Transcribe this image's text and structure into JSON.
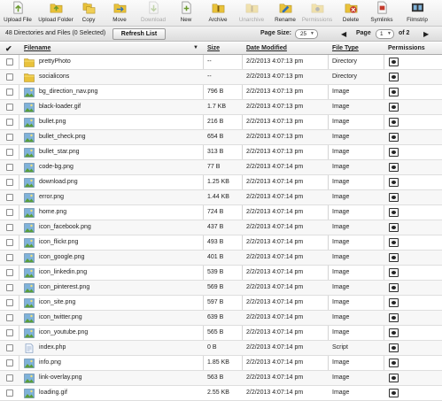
{
  "toolbar": {
    "buttons": [
      {
        "label": "Upload File",
        "icon": "upload-file-icon",
        "enabled": true
      },
      {
        "label": "Upload Folder",
        "icon": "upload-folder-icon",
        "enabled": true
      },
      {
        "label": "Copy",
        "icon": "copy-icon",
        "enabled": true
      },
      {
        "label": "Move",
        "icon": "move-icon",
        "enabled": true
      },
      {
        "label": "Download",
        "icon": "download-icon",
        "enabled": false
      },
      {
        "label": "New",
        "icon": "new-icon",
        "enabled": true
      },
      {
        "label": "Archive",
        "icon": "archive-icon",
        "enabled": true
      },
      {
        "label": "Unarchive",
        "icon": "unarchive-icon",
        "enabled": false
      },
      {
        "label": "Rename",
        "icon": "rename-icon",
        "enabled": true
      },
      {
        "label": "Permissions",
        "icon": "permissions-icon",
        "enabled": false
      },
      {
        "label": "Delete",
        "icon": "delete-icon",
        "enabled": true
      },
      {
        "label": "Symlinks",
        "icon": "symlinks-icon",
        "enabled": true
      },
      {
        "label": "Filmstrip",
        "icon": "filmstrip-icon",
        "enabled": true
      }
    ]
  },
  "status": {
    "summary": "48 Directories and Files (0 Selected)",
    "refresh_label": "Refresh List",
    "page_size_label": "Page Size:",
    "page_size_value": "25",
    "prev_icon": "prev-page-icon",
    "page_label": "Page",
    "page_value": "1",
    "page_of": "of 2",
    "next_icon": "next-page-icon"
  },
  "table": {
    "headers": {
      "check": "✔",
      "filename": "Filename",
      "size": "Size",
      "date": "Date Modified",
      "type": "File Type",
      "permissions": "Permissions"
    },
    "rows": [
      {
        "name": "prettyPhoto",
        "size": "--",
        "date": "2/2/2013 4:07:13 pm",
        "type": "Directory",
        "icon": "folder-icon"
      },
      {
        "name": "socialicons",
        "size": "--",
        "date": "2/2/2013 4:07:13 pm",
        "type": "Directory",
        "icon": "folder-icon"
      },
      {
        "name": "bg_direction_nav.png",
        "size": "796 B",
        "date": "2/2/2013 4:07:13 pm",
        "type": "Image",
        "icon": "image-file-icon"
      },
      {
        "name": "black-loader.gif",
        "size": "1.7 KB",
        "date": "2/2/2013 4:07:13 pm",
        "type": "Image",
        "icon": "image-file-icon"
      },
      {
        "name": "bullet.png",
        "size": "216 B",
        "date": "2/2/2013 4:07:13 pm",
        "type": "Image",
        "icon": "image-file-icon"
      },
      {
        "name": "bullet_check.png",
        "size": "654 B",
        "date": "2/2/2013 4:07:13 pm",
        "type": "Image",
        "icon": "image-file-icon"
      },
      {
        "name": "bullet_star.png",
        "size": "313 B",
        "date": "2/2/2013 4:07:13 pm",
        "type": "Image",
        "icon": "image-file-icon"
      },
      {
        "name": "code-bg.png",
        "size": "77 B",
        "date": "2/2/2013 4:07:14 pm",
        "type": "Image",
        "icon": "image-file-icon"
      },
      {
        "name": "download.png",
        "size": "1.25 KB",
        "date": "2/2/2013 4:07:14 pm",
        "type": "Image",
        "icon": "image-file-icon"
      },
      {
        "name": "error.png",
        "size": "1.44 KB",
        "date": "2/2/2013 4:07:14 pm",
        "type": "Image",
        "icon": "image-file-icon"
      },
      {
        "name": "home.png",
        "size": "724 B",
        "date": "2/2/2013 4:07:14 pm",
        "type": "Image",
        "icon": "image-file-icon"
      },
      {
        "name": "icon_facebook.png",
        "size": "437 B",
        "date": "2/2/2013 4:07:14 pm",
        "type": "Image",
        "icon": "image-file-icon"
      },
      {
        "name": "icon_flickr.png",
        "size": "493 B",
        "date": "2/2/2013 4:07:14 pm",
        "type": "Image",
        "icon": "image-file-icon"
      },
      {
        "name": "icon_google.png",
        "size": "401 B",
        "date": "2/2/2013 4:07:14 pm",
        "type": "Image",
        "icon": "image-file-icon"
      },
      {
        "name": "icon_linkedin.png",
        "size": "539 B",
        "date": "2/2/2013 4:07:14 pm",
        "type": "Image",
        "icon": "image-file-icon"
      },
      {
        "name": "icon_pinterest.png",
        "size": "569 B",
        "date": "2/2/2013 4:07:14 pm",
        "type": "Image",
        "icon": "image-file-icon"
      },
      {
        "name": "icon_site.png",
        "size": "597 B",
        "date": "2/2/2013 4:07:14 pm",
        "type": "Image",
        "icon": "image-file-icon"
      },
      {
        "name": "icon_twitter.png",
        "size": "639 B",
        "date": "2/2/2013 4:07:14 pm",
        "type": "Image",
        "icon": "image-file-icon"
      },
      {
        "name": "icon_youtube.png",
        "size": "565 B",
        "date": "2/2/2013 4:07:14 pm",
        "type": "Image",
        "icon": "image-file-icon"
      },
      {
        "name": "index.php",
        "size": "0 B",
        "date": "2/2/2013 4:07:14 pm",
        "type": "Script",
        "icon": "script-file-icon"
      },
      {
        "name": "info.png",
        "size": "1.85 KB",
        "date": "2/2/2013 4:07:14 pm",
        "type": "Image",
        "icon": "image-file-icon"
      },
      {
        "name": "link-overlay.png",
        "size": "563 B",
        "date": "2/2/2013 4:07:14 pm",
        "type": "Image",
        "icon": "image-file-icon"
      },
      {
        "name": "loading.gif",
        "size": "2.55 KB",
        "date": "2/2/2013 4:07:14 pm",
        "type": "Image",
        "icon": "image-file-icon"
      }
    ]
  },
  "colors": {
    "folder": "#e9c23a",
    "image_icon_green": "#5a9e3a",
    "image_icon_sky": "#7fb2d9",
    "delete_red": "#c43a2c",
    "accent_green": "#6a9a2e"
  }
}
